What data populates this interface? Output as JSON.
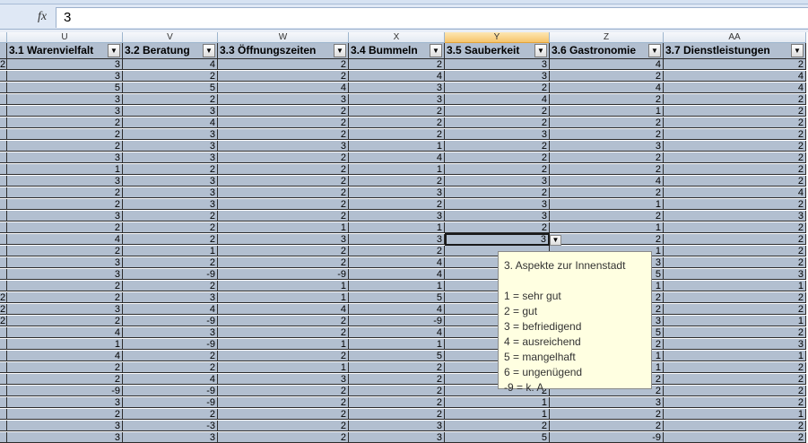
{
  "formula_bar": {
    "fx_label": "fx",
    "value": "3"
  },
  "columns": [
    {
      "letter": "U",
      "header": "3.1 Warenvielfalt"
    },
    {
      "letter": "V",
      "header": "3.2 Beratung"
    },
    {
      "letter": "W",
      "header": "3.3 Öffnungszeiten"
    },
    {
      "letter": "X",
      "header": "3.4 Bummeln"
    },
    {
      "letter": "Y",
      "header": "3.5 Sauberkeit"
    },
    {
      "letter": "Z",
      "header": "3.6 Gastronomie"
    },
    {
      "letter": "AA",
      "header": "3.7 Dienstleistungen"
    }
  ],
  "filter_arrow": "▼",
  "left_edge_col": [
    "2",
    "",
    "",
    "",
    "",
    "",
    "",
    "",
    "",
    "",
    "",
    "",
    "",
    "",
    "",
    "",
    "",
    "",
    "",
    "",
    "2",
    "2",
    "2",
    "",
    "",
    "",
    "",
    "",
    "",
    "",
    "",
    ""
  ],
  "rows": [
    [
      "3",
      "4",
      "2",
      "2",
      "3",
      "4",
      "2"
    ],
    [
      "3",
      "2",
      "2",
      "4",
      "3",
      "2",
      "4"
    ],
    [
      "5",
      "5",
      "4",
      "3",
      "2",
      "4",
      "4"
    ],
    [
      "3",
      "2",
      "3",
      "3",
      "4",
      "2",
      "2"
    ],
    [
      "3",
      "3",
      "2",
      "2",
      "2",
      "1",
      "2"
    ],
    [
      "2",
      "4",
      "2",
      "2",
      "2",
      "2",
      "2"
    ],
    [
      "2",
      "3",
      "2",
      "2",
      "3",
      "2",
      "2"
    ],
    [
      "2",
      "3",
      "3",
      "1",
      "2",
      "3",
      "2"
    ],
    [
      "3",
      "3",
      "2",
      "4",
      "2",
      "2",
      "2"
    ],
    [
      "1",
      "2",
      "2",
      "1",
      "2",
      "2",
      "2"
    ],
    [
      "3",
      "3",
      "2",
      "2",
      "3",
      "4",
      "2"
    ],
    [
      "2",
      "3",
      "2",
      "3",
      "2",
      "2",
      "4"
    ],
    [
      "2",
      "3",
      "2",
      "2",
      "3",
      "1",
      "2"
    ],
    [
      "3",
      "2",
      "2",
      "3",
      "3",
      "2",
      "3"
    ],
    [
      "2",
      "2",
      "1",
      "1",
      "2",
      "1",
      "2"
    ],
    [
      "4",
      "2",
      "3",
      "3",
      "3",
      "2",
      "2"
    ],
    [
      "2",
      "1",
      "2",
      "2",
      "",
      "1",
      "2"
    ],
    [
      "3",
      "2",
      "2",
      "4",
      "",
      "3",
      "2"
    ],
    [
      "3",
      "-9",
      "-9",
      "4",
      "",
      "5",
      "3"
    ],
    [
      "2",
      "2",
      "1",
      "1",
      "",
      "1",
      "1"
    ],
    [
      "2",
      "3",
      "1",
      "5",
      "",
      "2",
      "2"
    ],
    [
      "3",
      "4",
      "4",
      "4",
      "",
      "2",
      "2"
    ],
    [
      "2",
      "-9",
      "2",
      "-9",
      "",
      "3",
      "1"
    ],
    [
      "4",
      "3",
      "2",
      "4",
      "",
      "5",
      "2"
    ],
    [
      "1",
      "-9",
      "1",
      "1",
      "",
      "2",
      "3"
    ],
    [
      "4",
      "2",
      "2",
      "5",
      "",
      "1",
      "1"
    ],
    [
      "2",
      "2",
      "1",
      "2",
      "",
      "1",
      "2"
    ],
    [
      "2",
      "4",
      "3",
      "2",
      "",
      "2",
      "2"
    ],
    [
      "-9",
      "-9",
      "2",
      "2",
      "2",
      "2",
      "2"
    ],
    [
      "3",
      "-9",
      "2",
      "2",
      "1",
      "3",
      "2"
    ],
    [
      "2",
      "2",
      "2",
      "2",
      "1",
      "2",
      "1"
    ],
    [
      "3",
      "-3",
      "2",
      "3",
      "2",
      "2",
      "2"
    ],
    [
      "3",
      "3",
      "2",
      "3",
      "5",
      "-9",
      "2"
    ]
  ],
  "active_cell": {
    "row": 15,
    "col": 4,
    "value": "3"
  },
  "dropdown_arrow": "▼",
  "tooltip": {
    "title": "3. Aspekte zur Innenstadt",
    "lines": [
      "1 = sehr gut",
      "2 = gut",
      "3 = befriedigend",
      "4 = ausreichend",
      "5 = mangelhaft",
      "6 = ungenügend",
      "-9 = k. A."
    ]
  }
}
